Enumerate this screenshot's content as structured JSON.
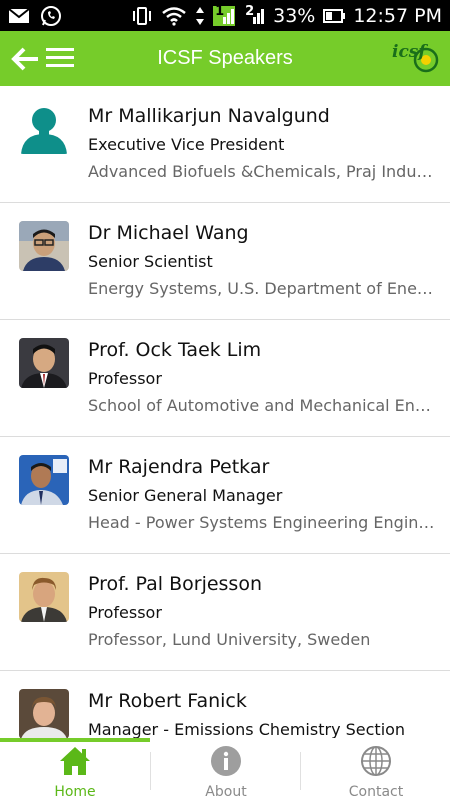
{
  "status_bar": {
    "battery": "33%",
    "time": "12:57 PM",
    "signal_1": "1",
    "signal_2": "2"
  },
  "app_bar": {
    "title": "ICSF Speakers",
    "logo_text": "icsf"
  },
  "speakers": [
    {
      "name": "Mr Mallikarjun Navalgund",
      "role": "Executive Vice President",
      "org": "Advanced Biofuels &Chemicals, Praj Industries"
    },
    {
      "name": "Dr Michael Wang",
      "role": "Senior Scientist",
      "org": "Energy Systems, U.S. Department of Energy."
    },
    {
      "name": "Prof. Ock Taek Lim",
      "role": "Professor",
      "org": "School of Automotive and Mechanical Engg."
    },
    {
      "name": "Mr Rajendra Petkar",
      "role": "Senior General Manager",
      "org": "Head - Power Systems Engineering Engineering"
    },
    {
      "name": "Prof. Pal Borjesson",
      "role": "Professor",
      "org": "Professor, Lund University, Sweden"
    },
    {
      "name": "Mr Robert Fanick",
      "role": "Manager - Emissions Chemistry Section",
      "org": ""
    }
  ],
  "bottom_nav": {
    "items": [
      {
        "label": "Home",
        "icon": "home-icon"
      },
      {
        "label": "About",
        "icon": "info-icon"
      },
      {
        "label": "Contact",
        "icon": "globe-icon"
      }
    ]
  },
  "colors": {
    "accent": "#76cc2a",
    "active_label": "#5bb818"
  }
}
